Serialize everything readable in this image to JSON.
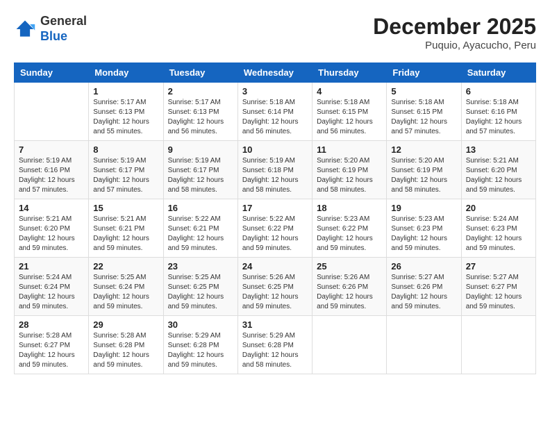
{
  "header": {
    "logo_line1": "General",
    "logo_line2": "Blue",
    "month_year": "December 2025",
    "location": "Puquio, Ayacucho, Peru"
  },
  "days_of_week": [
    "Sunday",
    "Monday",
    "Tuesday",
    "Wednesday",
    "Thursday",
    "Friday",
    "Saturday"
  ],
  "weeks": [
    [
      {
        "day": "",
        "info": ""
      },
      {
        "day": "1",
        "info": "Sunrise: 5:17 AM\nSunset: 6:13 PM\nDaylight: 12 hours\nand 55 minutes."
      },
      {
        "day": "2",
        "info": "Sunrise: 5:17 AM\nSunset: 6:13 PM\nDaylight: 12 hours\nand 56 minutes."
      },
      {
        "day": "3",
        "info": "Sunrise: 5:18 AM\nSunset: 6:14 PM\nDaylight: 12 hours\nand 56 minutes."
      },
      {
        "day": "4",
        "info": "Sunrise: 5:18 AM\nSunset: 6:15 PM\nDaylight: 12 hours\nand 56 minutes."
      },
      {
        "day": "5",
        "info": "Sunrise: 5:18 AM\nSunset: 6:15 PM\nDaylight: 12 hours\nand 57 minutes."
      },
      {
        "day": "6",
        "info": "Sunrise: 5:18 AM\nSunset: 6:16 PM\nDaylight: 12 hours\nand 57 minutes."
      }
    ],
    [
      {
        "day": "7",
        "info": "Sunrise: 5:19 AM\nSunset: 6:16 PM\nDaylight: 12 hours\nand 57 minutes."
      },
      {
        "day": "8",
        "info": "Sunrise: 5:19 AM\nSunset: 6:17 PM\nDaylight: 12 hours\nand 57 minutes."
      },
      {
        "day": "9",
        "info": "Sunrise: 5:19 AM\nSunset: 6:17 PM\nDaylight: 12 hours\nand 58 minutes."
      },
      {
        "day": "10",
        "info": "Sunrise: 5:19 AM\nSunset: 6:18 PM\nDaylight: 12 hours\nand 58 minutes."
      },
      {
        "day": "11",
        "info": "Sunrise: 5:20 AM\nSunset: 6:19 PM\nDaylight: 12 hours\nand 58 minutes."
      },
      {
        "day": "12",
        "info": "Sunrise: 5:20 AM\nSunset: 6:19 PM\nDaylight: 12 hours\nand 58 minutes."
      },
      {
        "day": "13",
        "info": "Sunrise: 5:21 AM\nSunset: 6:20 PM\nDaylight: 12 hours\nand 59 minutes."
      }
    ],
    [
      {
        "day": "14",
        "info": "Sunrise: 5:21 AM\nSunset: 6:20 PM\nDaylight: 12 hours\nand 59 minutes."
      },
      {
        "day": "15",
        "info": "Sunrise: 5:21 AM\nSunset: 6:21 PM\nDaylight: 12 hours\nand 59 minutes."
      },
      {
        "day": "16",
        "info": "Sunrise: 5:22 AM\nSunset: 6:21 PM\nDaylight: 12 hours\nand 59 minutes."
      },
      {
        "day": "17",
        "info": "Sunrise: 5:22 AM\nSunset: 6:22 PM\nDaylight: 12 hours\nand 59 minutes."
      },
      {
        "day": "18",
        "info": "Sunrise: 5:23 AM\nSunset: 6:22 PM\nDaylight: 12 hours\nand 59 minutes."
      },
      {
        "day": "19",
        "info": "Sunrise: 5:23 AM\nSunset: 6:23 PM\nDaylight: 12 hours\nand 59 minutes."
      },
      {
        "day": "20",
        "info": "Sunrise: 5:24 AM\nSunset: 6:23 PM\nDaylight: 12 hours\nand 59 minutes."
      }
    ],
    [
      {
        "day": "21",
        "info": "Sunrise: 5:24 AM\nSunset: 6:24 PM\nDaylight: 12 hours\nand 59 minutes."
      },
      {
        "day": "22",
        "info": "Sunrise: 5:25 AM\nSunset: 6:24 PM\nDaylight: 12 hours\nand 59 minutes."
      },
      {
        "day": "23",
        "info": "Sunrise: 5:25 AM\nSunset: 6:25 PM\nDaylight: 12 hours\nand 59 minutes."
      },
      {
        "day": "24",
        "info": "Sunrise: 5:26 AM\nSunset: 6:25 PM\nDaylight: 12 hours\nand 59 minutes."
      },
      {
        "day": "25",
        "info": "Sunrise: 5:26 AM\nSunset: 6:26 PM\nDaylight: 12 hours\nand 59 minutes."
      },
      {
        "day": "26",
        "info": "Sunrise: 5:27 AM\nSunset: 6:26 PM\nDaylight: 12 hours\nand 59 minutes."
      },
      {
        "day": "27",
        "info": "Sunrise: 5:27 AM\nSunset: 6:27 PM\nDaylight: 12 hours\nand 59 minutes."
      }
    ],
    [
      {
        "day": "28",
        "info": "Sunrise: 5:28 AM\nSunset: 6:27 PM\nDaylight: 12 hours\nand 59 minutes."
      },
      {
        "day": "29",
        "info": "Sunrise: 5:28 AM\nSunset: 6:28 PM\nDaylight: 12 hours\nand 59 minutes."
      },
      {
        "day": "30",
        "info": "Sunrise: 5:29 AM\nSunset: 6:28 PM\nDaylight: 12 hours\nand 59 minutes."
      },
      {
        "day": "31",
        "info": "Sunrise: 5:29 AM\nSunset: 6:28 PM\nDaylight: 12 hours\nand 58 minutes."
      },
      {
        "day": "",
        "info": ""
      },
      {
        "day": "",
        "info": ""
      },
      {
        "day": "",
        "info": ""
      }
    ]
  ]
}
